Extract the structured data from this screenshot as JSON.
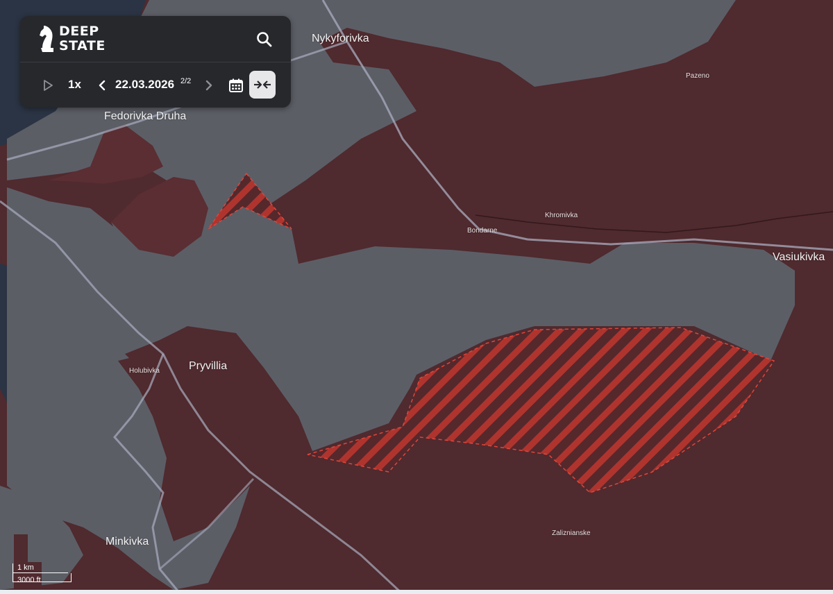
{
  "app": {
    "logo_line1": "DEEP",
    "logo_line2": "STATE"
  },
  "toolbar": {
    "speed": "1x",
    "date": "22.03.2026",
    "page": "2/2"
  },
  "icons": {
    "logo": "knight-chess-icon",
    "search": "search-icon",
    "play": "play-icon",
    "prev": "chevron-left-icon",
    "next": "chevron-right-icon",
    "calendar": "calendar-icon",
    "compare": "compare-arrows-icon"
  },
  "places": {
    "nykyforivka": "Nykyforivka",
    "fedorivka_druha": "Fedorivka Druha",
    "pazeno": "Pazeno",
    "khromivka": "Khromivka",
    "bondarne": "Bondarne",
    "vasiukivka": "Vasiukivka",
    "holubivka": "Holubivka",
    "pryvillia": "Pryvillia",
    "minkivka": "Minkivka",
    "zaliznianske": "Zaliznianske"
  },
  "scale": {
    "metric": "1 km",
    "imperial": "3000 ft"
  },
  "colors": {
    "occupied": "#4f2a2e",
    "contested_hatch": "#b0342e",
    "free_territory": "#5c5e66",
    "water": "#2b3444",
    "road": "#a9aec0",
    "panel": "#26282c"
  }
}
